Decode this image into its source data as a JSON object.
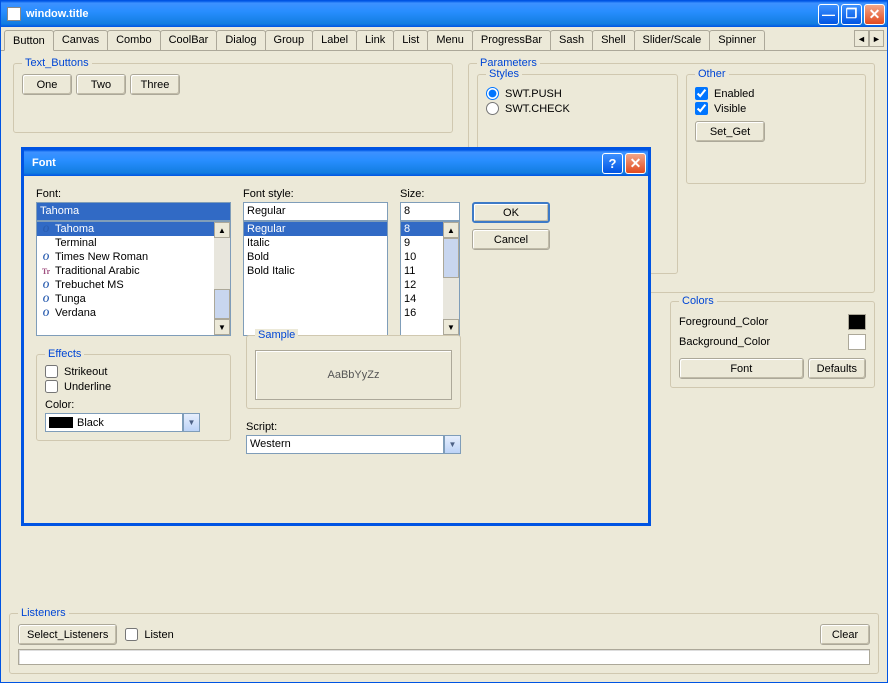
{
  "window": {
    "title": "window.title"
  },
  "tabs": [
    "Button",
    "Canvas",
    "Combo",
    "CoolBar",
    "Dialog",
    "Group",
    "Label",
    "Link",
    "List",
    "Menu",
    "ProgressBar",
    "Sash",
    "Shell",
    "Slider/Scale",
    "Spinner"
  ],
  "active_tab": "Button",
  "text_buttons": {
    "label": "Text_Buttons",
    "items": [
      "One",
      "Two",
      "Three"
    ]
  },
  "parameters": {
    "label": "Parameters",
    "styles": {
      "label": "Styles",
      "options": [
        "SWT.PUSH",
        "SWT.CHECK"
      ],
      "selected": "SWT.PUSH"
    },
    "other": {
      "label": "Other",
      "enabled_label": "Enabled",
      "enabled": true,
      "visible_label": "Visible",
      "visible": true,
      "setget_label": "Set_Get"
    }
  },
  "colors_group": {
    "label": "Colors",
    "fg_label": "Foreground_Color",
    "fg": "#000000",
    "bg_label": "Background_Color",
    "bg": "#ffffff",
    "font_btn": "Font",
    "defaults_btn": "Defaults"
  },
  "listeners": {
    "label": "Listeners",
    "select_btn": "Select_Listeners",
    "listen_label": "Listen",
    "clear_btn": "Clear"
  },
  "font_dialog": {
    "title": "Font",
    "font_label": "Font:",
    "font_value": "Tahoma",
    "fonts": [
      {
        "name": "Tahoma",
        "icon": "O"
      },
      {
        "name": "Terminal",
        "icon": ""
      },
      {
        "name": "Times New Roman",
        "icon": "O"
      },
      {
        "name": "Traditional Arabic",
        "icon": "Tr"
      },
      {
        "name": "Trebuchet MS",
        "icon": "O"
      },
      {
        "name": "Tunga",
        "icon": "O"
      },
      {
        "name": "Verdana",
        "icon": "O"
      }
    ],
    "font_selected": "Tahoma",
    "style_label": "Font style:",
    "style_value": "Regular",
    "styles": [
      "Regular",
      "Italic",
      "Bold",
      "Bold Italic"
    ],
    "style_selected": "Regular",
    "size_label": "Size:",
    "size_value": "8",
    "sizes": [
      "8",
      "9",
      "10",
      "11",
      "12",
      "14",
      "16"
    ],
    "size_selected": "8",
    "ok": "OK",
    "cancel": "Cancel",
    "effects_label": "Effects",
    "strikeout_label": "Strikeout",
    "strikeout": false,
    "underline_label": "Underline",
    "underline": false,
    "color_label": "Color:",
    "color_value": "Black",
    "sample_label": "Sample",
    "sample_text": "AaBbYyZz",
    "script_label": "Script:",
    "script_value": "Western"
  }
}
